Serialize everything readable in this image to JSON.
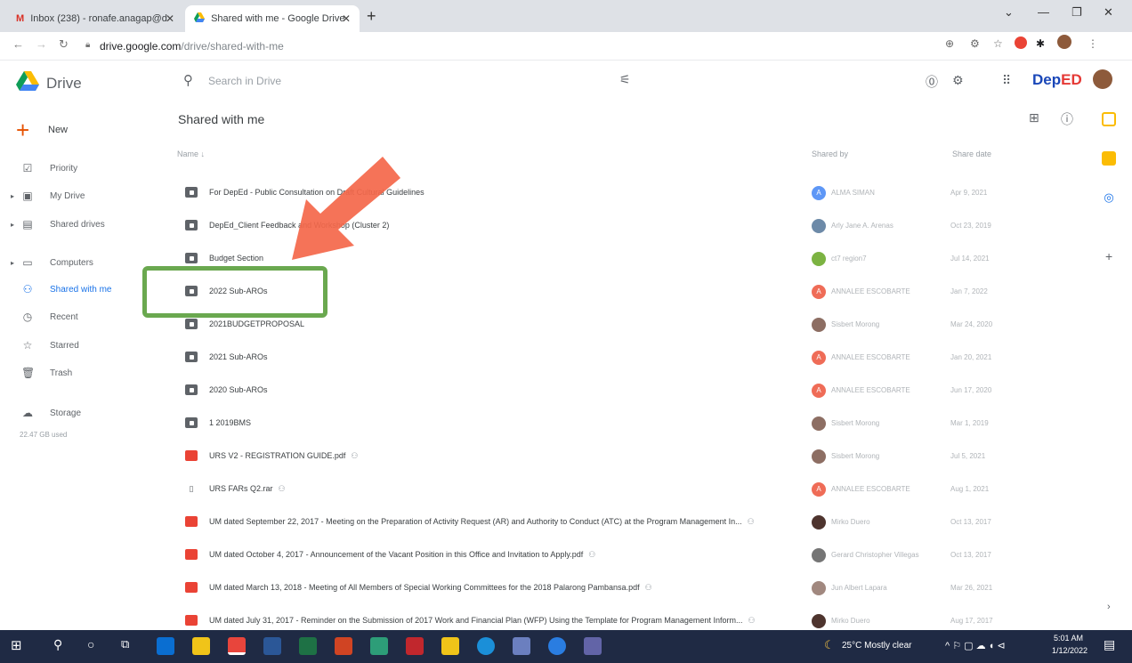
{
  "browser": {
    "tabs": [
      {
        "label": "Inbox (238) - ronafe.anagap@d"
      },
      {
        "label": "Shared with me - Google Drive"
      }
    ],
    "url_host": "drive.google.com",
    "url_path": "/drive/shared-with-me"
  },
  "drive": {
    "app_name": "Drive",
    "search_placeholder": "Search in Drive",
    "brand": {
      "part1": "Dep",
      "part2": "ED"
    }
  },
  "sidebar": {
    "new_label": "New",
    "items": [
      {
        "label": "Priority",
        "icon": "priority-icon"
      },
      {
        "label": "My Drive",
        "icon": "my-drive-icon"
      },
      {
        "label": "Shared drives",
        "icon": "shared-drives-icon"
      },
      {
        "label": "Computers",
        "icon": "computers-icon"
      },
      {
        "label": "Shared with me",
        "icon": "shared-with-me-icon"
      },
      {
        "label": "Recent",
        "icon": "recent-icon"
      },
      {
        "label": "Starred",
        "icon": "star-icon"
      },
      {
        "label": "Trash",
        "icon": "trash-icon"
      },
      {
        "label": "Storage",
        "icon": "cloud-icon"
      }
    ],
    "storage_used": "22.47 GB used"
  },
  "main": {
    "title": "Shared with me",
    "columns": {
      "name": "Name ↓",
      "shared_by": "Shared by",
      "share_date": "Share date"
    },
    "rows": [
      {
        "type": "folder",
        "name": "For DepEd - Public Consultation on Draft Cultural Guidelines",
        "shared": false,
        "owner": "ALMA SIMAN",
        "date": "Apr 9, 2021",
        "av": "A",
        "avcolor": "#5e97f6"
      },
      {
        "type": "folder",
        "name": "DepEd_Client Feedback and Workshop (Cluster 2)",
        "shared": false,
        "owner": "Arly Jane A. Arenas",
        "date": "Oct 23, 2019",
        "av": "",
        "avcolor": "#6d8aa8"
      },
      {
        "type": "folder",
        "name": "Budget Section",
        "shared": false,
        "owner": "ct7 region7",
        "date": "Jul 14, 2021",
        "av": "",
        "avcolor": "#7cb342"
      },
      {
        "type": "folder",
        "name": "2022 Sub-AROs",
        "shared": false,
        "owner": "ANNALEE ESCOBARTE",
        "date": "Jan 7, 2022",
        "av": "A",
        "avcolor": "#ef6c57"
      },
      {
        "type": "folder",
        "name": "2021BUDGETPROPOSAL",
        "shared": false,
        "owner": "Sisbert Morong",
        "date": "Mar 24, 2020",
        "av": "",
        "avcolor": "#8d6e63"
      },
      {
        "type": "folder",
        "name": "2021 Sub-AROs",
        "shared": false,
        "owner": "ANNALEE ESCOBARTE",
        "date": "Jan 20, 2021",
        "av": "A",
        "avcolor": "#ef6c57"
      },
      {
        "type": "folder",
        "name": "2020 Sub-AROs",
        "shared": false,
        "owner": "ANNALEE ESCOBARTE",
        "date": "Jun 17, 2020",
        "av": "A",
        "avcolor": "#ef6c57"
      },
      {
        "type": "folder",
        "name": "1 2019BMS",
        "shared": false,
        "owner": "Sisbert Morong",
        "date": "Mar 1, 2019",
        "av": "",
        "avcolor": "#8d6e63"
      },
      {
        "type": "pdf",
        "name": "URS V2 - REGISTRATION GUIDE.pdf",
        "shared": true,
        "owner": "Sisbert Morong",
        "date": "Jul 5, 2021",
        "av": "",
        "avcolor": "#8d6e63"
      },
      {
        "type": "rar",
        "name": "URS FARs Q2.rar",
        "shared": true,
        "owner": "ANNALEE ESCOBARTE",
        "date": "Aug 1, 2021",
        "av": "A",
        "avcolor": "#ef6c57"
      },
      {
        "type": "pdf",
        "name": "UM dated September 22, 2017 - Meeting on the Preparation of Activity Request (AR) and Authority to Conduct (ATC) at the Program Management In...",
        "shared": true,
        "owner": "Mirko Duero",
        "date": "Oct 13, 2017",
        "av": "",
        "avcolor": "#4e342e"
      },
      {
        "type": "pdf",
        "name": "UM dated October 4, 2017 - Announcement of the Vacant Position in this Office and Invitation to Apply.pdf",
        "shared": true,
        "owner": "Gerard Christopher Villegas",
        "date": "Oct 13, 2017",
        "av": "",
        "avcolor": "#757575"
      },
      {
        "type": "pdf",
        "name": "UM dated March 13, 2018 - Meeting of All Members of Special Working Committees for the 2018 Palarong Pambansa.pdf",
        "shared": true,
        "owner": "Jun Albert Lapara",
        "date": "Mar 26, 2021",
        "av": "",
        "avcolor": "#a1887f"
      },
      {
        "type": "pdf",
        "name": "UM dated July 31, 2017 - Reminder on the Submission of 2017 Work and Financial Plan (WFP) Using the Template for Program Management Inform...",
        "shared": true,
        "owner": "Mirko Duero",
        "date": "Aug 17, 2017",
        "av": "",
        "avcolor": "#4e342e"
      }
    ],
    "shared_glyph": "⚇"
  },
  "taskbar": {
    "weather": "25°C  Mostly clear",
    "time": "5:01 AM",
    "date": "1/12/2022"
  },
  "colors": {
    "accent": "#1a73e8",
    "highlight_box": "#6aa84f",
    "arrow": "#f4674a",
    "taskbar": "#1f2a44"
  }
}
